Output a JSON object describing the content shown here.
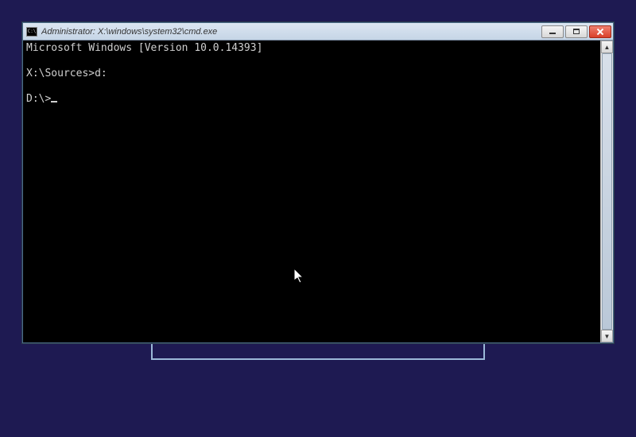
{
  "window": {
    "sys_icon_text": "C:\\",
    "title": "Administrator: X:\\windows\\system32\\cmd.exe"
  },
  "terminal": {
    "line1": "Microsoft Windows [Version 10.0.14393]",
    "blank": "",
    "line2_prompt": "X:\\Sources>",
    "line2_cmd": "d:",
    "line3_prompt": "D:\\>"
  },
  "scrollbar": {
    "thumb_top_pct": 0,
    "thumb_height_pct": 100
  },
  "icons": {
    "up": "▲",
    "down": "▼"
  }
}
